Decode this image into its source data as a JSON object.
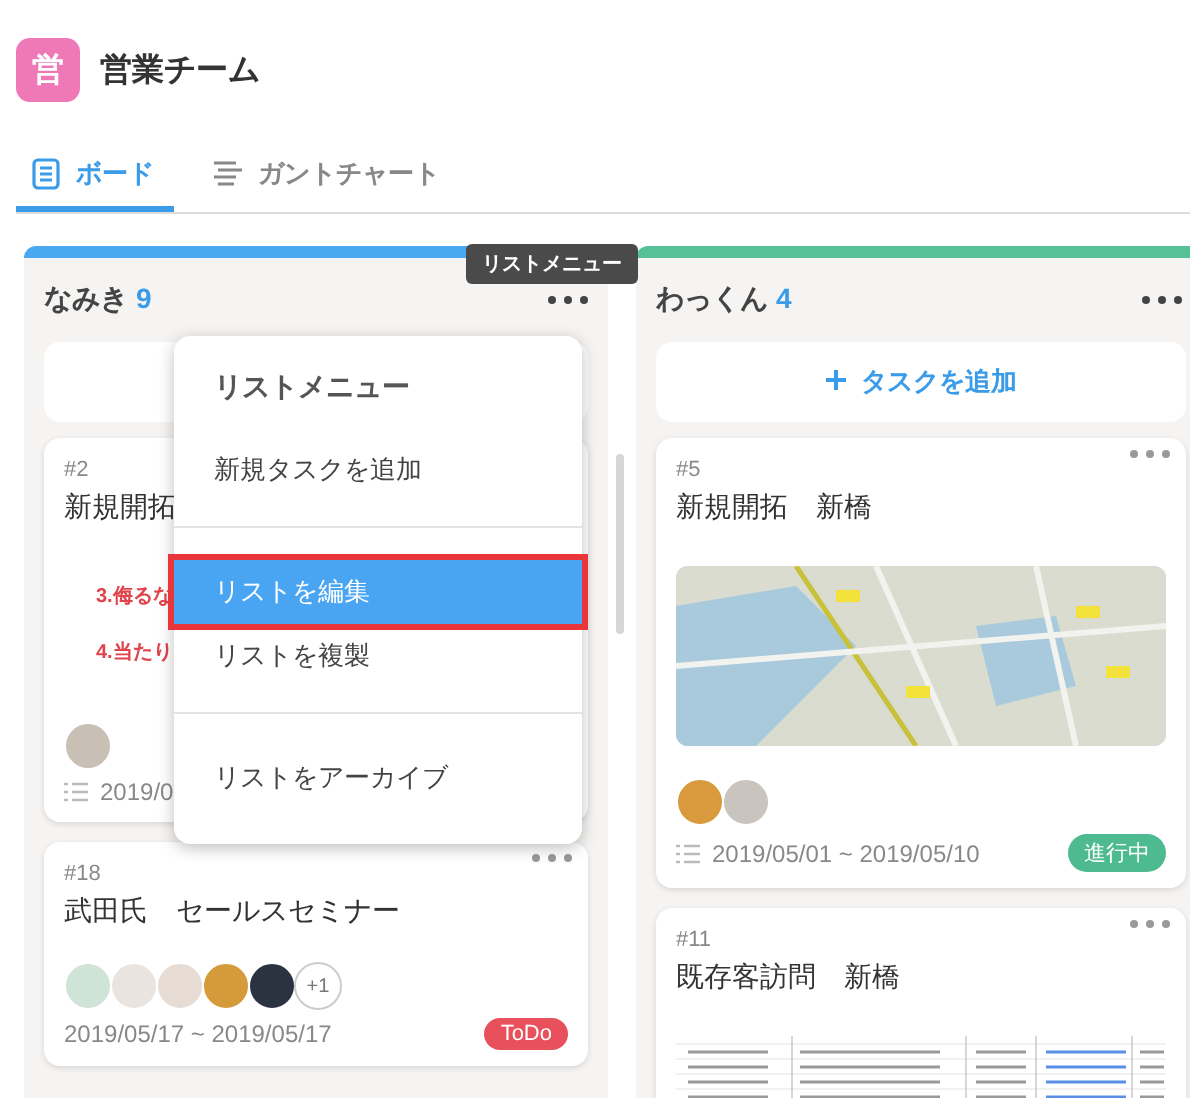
{
  "team": {
    "initial": "営",
    "name": "営業チーム"
  },
  "tabs": [
    {
      "label": "ボード",
      "selected": true,
      "kind": "board"
    },
    {
      "label": "ガントチャート",
      "selected": false,
      "kind": "gantt"
    }
  ],
  "tooltip": "リストメニュー",
  "lists": [
    {
      "name": "なみき",
      "count": "9",
      "color": "#4aa8f0",
      "cards": [
        {
          "kind": "notes",
          "number": "#2",
          "title": "新規開拓",
          "notes": [
            "3.侮るな",
            "4.当たり"
          ],
          "avatars": [
            {
              "color": "#c8c0b4"
            }
          ],
          "date": "2019/0"
        },
        {
          "kind": "plain",
          "number": "#18",
          "title": "武田氏　セールスセミナー",
          "avatars": [
            {
              "color": "#cfe3d6"
            },
            {
              "color": "#e9e4e0"
            },
            {
              "color": "#e6dcd4"
            },
            {
              "color": "#d59a3a"
            },
            {
              "color": "#2b3340"
            }
          ],
          "more": "+1",
          "date": "2019/05/17 ~ 2019/05/17",
          "status": {
            "label": "ToDo",
            "color": "#e8505b"
          }
        }
      ]
    },
    {
      "name": "わっくん",
      "count": "4",
      "color": "#56c197",
      "add_task": "タスクを追加",
      "cards": [
        {
          "kind": "map",
          "number": "#5",
          "title": "新規開拓　新橋",
          "avatars": [
            {
              "color": "#d89a3c"
            },
            {
              "color": "#c9c4bd"
            }
          ],
          "date": "2019/05/01 ~ 2019/05/10",
          "status": {
            "label": "進行中",
            "color": "#4dbb8f"
          }
        },
        {
          "kind": "sheet",
          "number": "#11",
          "title": "既存客訪問　新橋"
        }
      ]
    }
  ],
  "menu": {
    "title": "リストメニュー",
    "groups": [
      [
        {
          "label": "新規タスクを追加",
          "selected": false
        }
      ],
      [
        {
          "label": "リストを編集",
          "selected": true
        },
        {
          "label": "リストを複製",
          "selected": false
        }
      ],
      [
        {
          "label": "リストをアーカイブ",
          "selected": false
        }
      ]
    ]
  }
}
